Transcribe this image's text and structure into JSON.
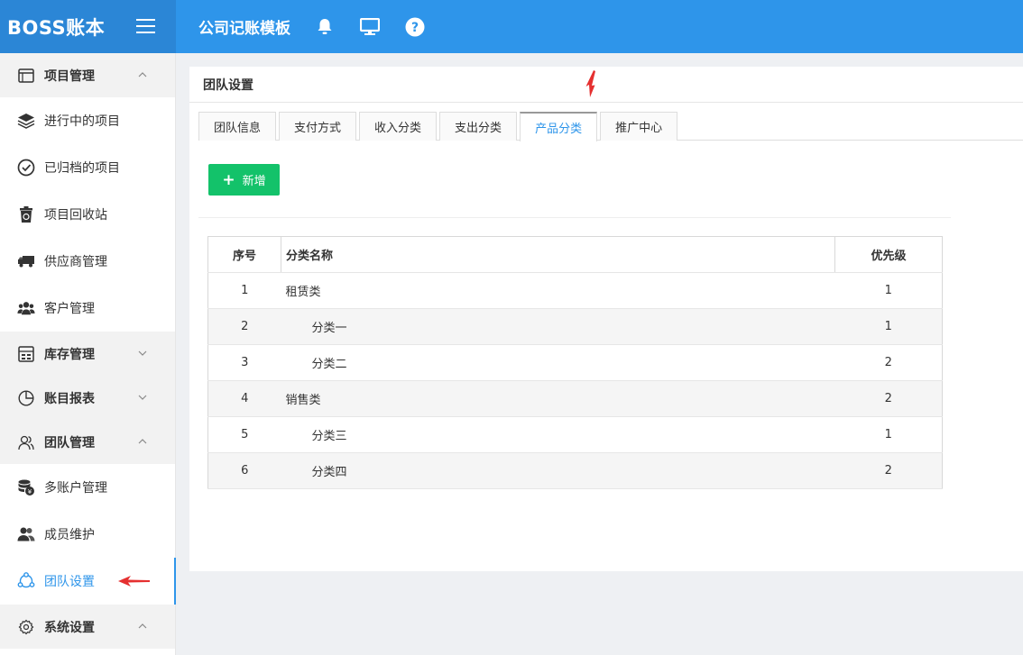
{
  "app": {
    "logo": "BOSS账本",
    "title": "公司记账模板"
  },
  "topbar": {
    "icons": [
      "bell-icon",
      "monitor-icon",
      "help-icon"
    ]
  },
  "sidebar": {
    "groups": [
      {
        "label": "项目管理",
        "icon": "window-icon",
        "expanded": true,
        "items": [
          {
            "label": "进行中的项目",
            "icon": "layers-icon"
          },
          {
            "label": "已归档的项目",
            "icon": "check-circle-icon"
          },
          {
            "label": "项目回收站",
            "icon": "recycle-bin-icon"
          },
          {
            "label": "供应商管理",
            "icon": "truck-icon"
          },
          {
            "label": "客户管理",
            "icon": "users-icon"
          }
        ]
      },
      {
        "label": "库存管理",
        "icon": "inventory-icon",
        "expanded": false,
        "items": []
      },
      {
        "label": "账目报表",
        "icon": "pie-chart-icon",
        "expanded": false,
        "items": []
      },
      {
        "label": "团队管理",
        "icon": "team-icon",
        "expanded": true,
        "items": [
          {
            "label": "多账户管理",
            "icon": "coins-icon"
          },
          {
            "label": "成员维护",
            "icon": "members-icon"
          },
          {
            "label": "团队设置",
            "icon": "team-settings-icon",
            "active": true
          }
        ]
      },
      {
        "label": "系统设置",
        "icon": "gear-icon",
        "expanded": true,
        "items": []
      }
    ]
  },
  "page": {
    "title": "团队设置",
    "tabs": [
      "团队信息",
      "支付方式",
      "收入分类",
      "支出分类",
      "产品分类",
      "推广中心"
    ],
    "active_tab": "产品分类",
    "add_button": "新增",
    "table": {
      "headers": [
        "序号",
        "分类名称",
        "优先级"
      ],
      "rows": [
        {
          "no": "1",
          "name": "租赁类",
          "priority": "1",
          "level": 0
        },
        {
          "no": "2",
          "name": "分类一",
          "priority": "1",
          "level": 1
        },
        {
          "no": "3",
          "name": "分类二",
          "priority": "2",
          "level": 1
        },
        {
          "no": "4",
          "name": "销售类",
          "priority": "2",
          "level": 0
        },
        {
          "no": "5",
          "name": "分类三",
          "priority": "1",
          "level": 1
        },
        {
          "no": "6",
          "name": "分类四",
          "priority": "2",
          "level": 1
        }
      ]
    }
  },
  "colors": {
    "topbar": "#2e95ea",
    "logo_bg": "#2b86d6",
    "accent": "#2e95ea",
    "add_button": "#13c26a",
    "annotation_arrow": "#e53030"
  }
}
